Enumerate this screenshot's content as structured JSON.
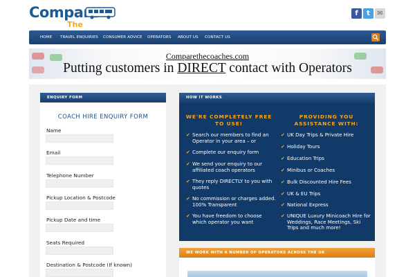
{
  "header": {
    "logo_line1": "Compare",
    "logo_line2": "The Coaches",
    "social": [
      {
        "name": "facebook-icon",
        "glyph": "f"
      },
      {
        "name": "twitter-icon",
        "glyph": "t"
      },
      {
        "name": "email-icon",
        "glyph": "✉"
      }
    ]
  },
  "nav": {
    "items": [
      "HOME",
      "TRAVEL ENQUIRIES",
      "CONSUMER ADVICE",
      "OPERATORS",
      "ABOUT US",
      "CONTACT US"
    ]
  },
  "banner": {
    "site": "Comparethecoaches.com",
    "tag_before": "Putting customers in ",
    "tag_emph": "DIRECT",
    "tag_after": " contact with Operators"
  },
  "enquiry": {
    "header": "ENQUIRY FORM",
    "title": "COACH HIRE ENQUIRY FORM",
    "fields": [
      {
        "label": "Name",
        "value": ""
      },
      {
        "label": "Email",
        "value": ""
      },
      {
        "label": "Telephone Number",
        "value": ""
      },
      {
        "label": "Pickup Location & Postcode",
        "value": ""
      },
      {
        "label": "Pickup Date and time",
        "value": ""
      },
      {
        "label": "Seats Required",
        "value": ""
      },
      {
        "label": "Destination & Postcode (If known)",
        "value": ""
      }
    ]
  },
  "how_it_works": {
    "header": "HOW IT WORKS",
    "left_title": "WE'RE COMPLETELY FREE TO USE!",
    "left_items": [
      "Search our members to find an Operator in your area – or",
      "Complete our enquiry form",
      "We send your enquiry to our affiliated coach operators",
      "They reply DIRECTLY to you with quotes",
      "No commission or charges added. 100% Transparent",
      "You have freedom to choose which operator you want"
    ],
    "right_title": "PROVIDING YOU ASSISTANCE WITH:",
    "right_items": [
      "UK Day Trips & Private Hire",
      "Holiday Tours",
      "Education Trips",
      "Minibus or Coaches",
      "Bulk Discounted Hire Fees",
      "UK & EU Trips",
      "National Express",
      "UNIQUE Luxury Minicoach Hire for Weddings, Race Meetings, Ski Trips and much more!"
    ]
  },
  "operators": {
    "header": "WE WORK WITH A NUMBER OF OPERATORS ACROSS THE UK"
  },
  "colors": {
    "brand_blue": "#1d5a93",
    "accent_orange": "#f4a623",
    "panel_navy": "#123a69"
  }
}
